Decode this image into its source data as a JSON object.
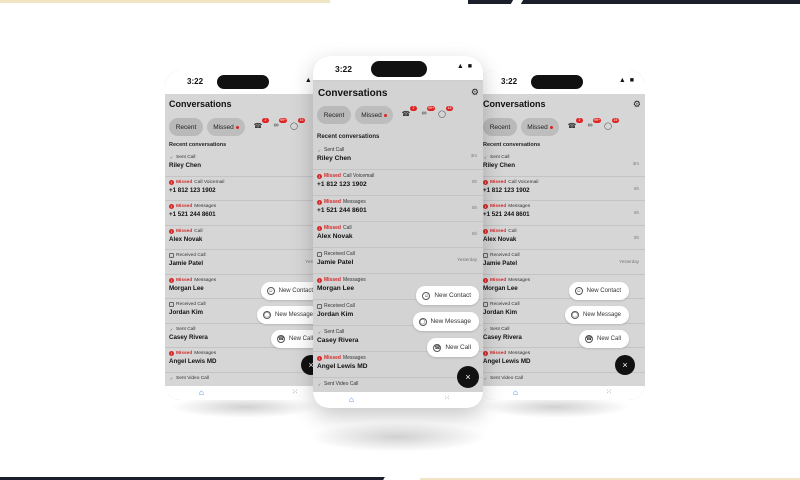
{
  "status": {
    "time": "3:22",
    "icons": "▲ ■"
  },
  "header": {
    "title": "Conversations"
  },
  "filters": {
    "recent": "Recent",
    "missed": "Missed",
    "badges": [
      "2",
      "99+",
      "15"
    ]
  },
  "section_label": "Recent conversations",
  "conversations": [
    {
      "type": "Sent Call",
      "missed": false,
      "icon": "check",
      "name": "Riley Chen",
      "time": "3m"
    },
    {
      "type": "Call Voicemail",
      "missed": true,
      "missed_label": "Missed",
      "icon": "red",
      "name": "+1 812 123 1902",
      "time": "5h"
    },
    {
      "type": "Messages",
      "missed": true,
      "missed_label": "Missed",
      "icon": "red",
      "name": "+1 521 244 8601",
      "time": "5h"
    },
    {
      "type": "Call",
      "missed": true,
      "missed_label": "Missed",
      "icon": "red",
      "name": "Alex Novak",
      "time": "5h"
    },
    {
      "type": "Received Call",
      "missed": false,
      "icon": "grey",
      "name": "Jamie Patel",
      "time": "Yesterday"
    },
    {
      "type": "Messages",
      "missed": true,
      "missed_label": "Missed",
      "icon": "red",
      "name": "Morgan Lee",
      "time": ""
    },
    {
      "type": "Received Call",
      "missed": false,
      "icon": "grey",
      "name": "Jordan Kim",
      "time": ""
    },
    {
      "type": "Sent Call",
      "missed": false,
      "icon": "check",
      "name": "Casey Rivera",
      "time": ""
    },
    {
      "type": "Messages",
      "missed": true,
      "missed_label": "Missed",
      "icon": "red",
      "name": "Angel Lewis MD",
      "time": ""
    },
    {
      "type": "Sent Video Call",
      "missed": false,
      "icon": "check",
      "name": "",
      "time": ""
    }
  ],
  "fab_menu": {
    "new_contact": "New Contact",
    "new_message": "New Message",
    "new_call": "New Call",
    "close": "×"
  },
  "tabbar": {
    "home_icon": "home-icon",
    "dialpad_icon": "dialpad-icon"
  },
  "colors": {
    "accent": "#2c7be5",
    "missed": "#d42a2a",
    "fab": "#111111"
  }
}
